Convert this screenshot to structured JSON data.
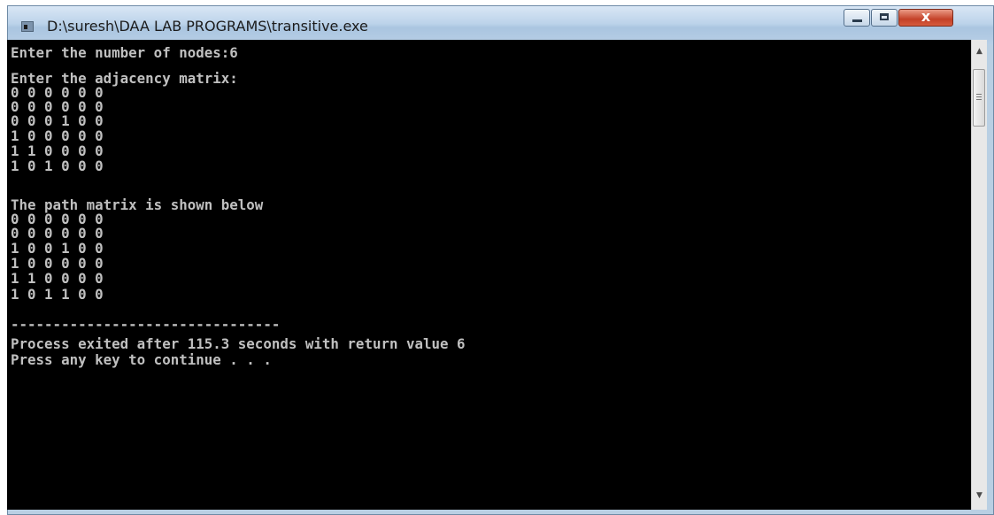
{
  "window": {
    "title": "D:\\suresh\\DAA LAB PROGRAMS\\transitive.exe",
    "controls": {
      "minimize": "minimize-icon",
      "maximize": "maximize-icon",
      "close_glyph": "x"
    }
  },
  "console": {
    "lines": [
      "Enter the number of nodes:6",
      "Enter the adjacency matrix:",
      "0 0 0 0 0 0",
      "0 0 0 0 0 0",
      "0 0 0 1 0 0",
      "1 0 0 0 0 0",
      "1 1 0 0 0 0",
      "1 0 1 0 0 0",
      "The path matrix is shown below",
      "0 0 0 0 0 0",
      "0 0 0 0 0 0",
      "1 0 0 1 0 0",
      "1 0 0 0 0 0",
      "1 1 0 0 0 0",
      "1 0 1 1 0 0",
      "--------------------------------",
      "Process exited after 115.3 seconds with return value 6",
      "Press any key to continue . . ."
    ]
  },
  "colors": {
    "console_bg": "#000000",
    "console_text": "#c0c0c0",
    "titlebar": "#bcd3ea",
    "close_button": "#c44128"
  }
}
